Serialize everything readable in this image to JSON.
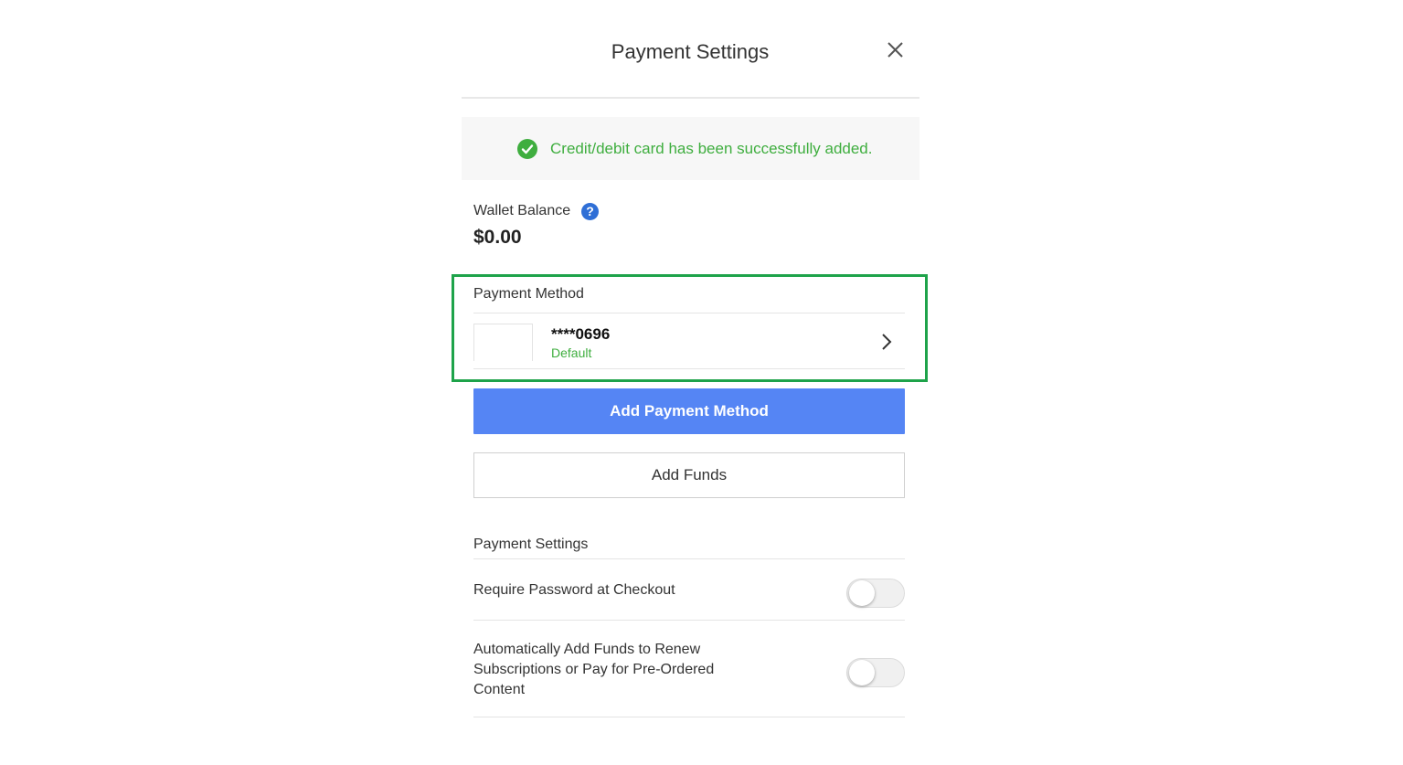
{
  "header": {
    "title": "Payment Settings",
    "close_icon": "close-icon"
  },
  "banner": {
    "icon": "check-circle-icon",
    "message": "Credit/debit card has been successfully added.",
    "color": "#3fae3f"
  },
  "wallet": {
    "label": "Wallet Balance",
    "help_icon": "help-icon",
    "balance": "$0.00"
  },
  "payment_method": {
    "title": "Payment Method",
    "card_number": "****0696",
    "card_status": "Default",
    "chevron_icon": "chevron-right-icon"
  },
  "buttons": {
    "add_payment_method": "Add Payment Method",
    "add_funds": "Add Funds",
    "primary_color": "#5585f4"
  },
  "settings": {
    "title": "Payment Settings",
    "items": [
      {
        "label": "Require Password at Checkout",
        "enabled": false
      },
      {
        "label": "Automatically Add Funds to Renew Subscriptions or Pay for Pre-Ordered Content",
        "enabled": false
      }
    ]
  },
  "highlight_color": "#1ea34a"
}
